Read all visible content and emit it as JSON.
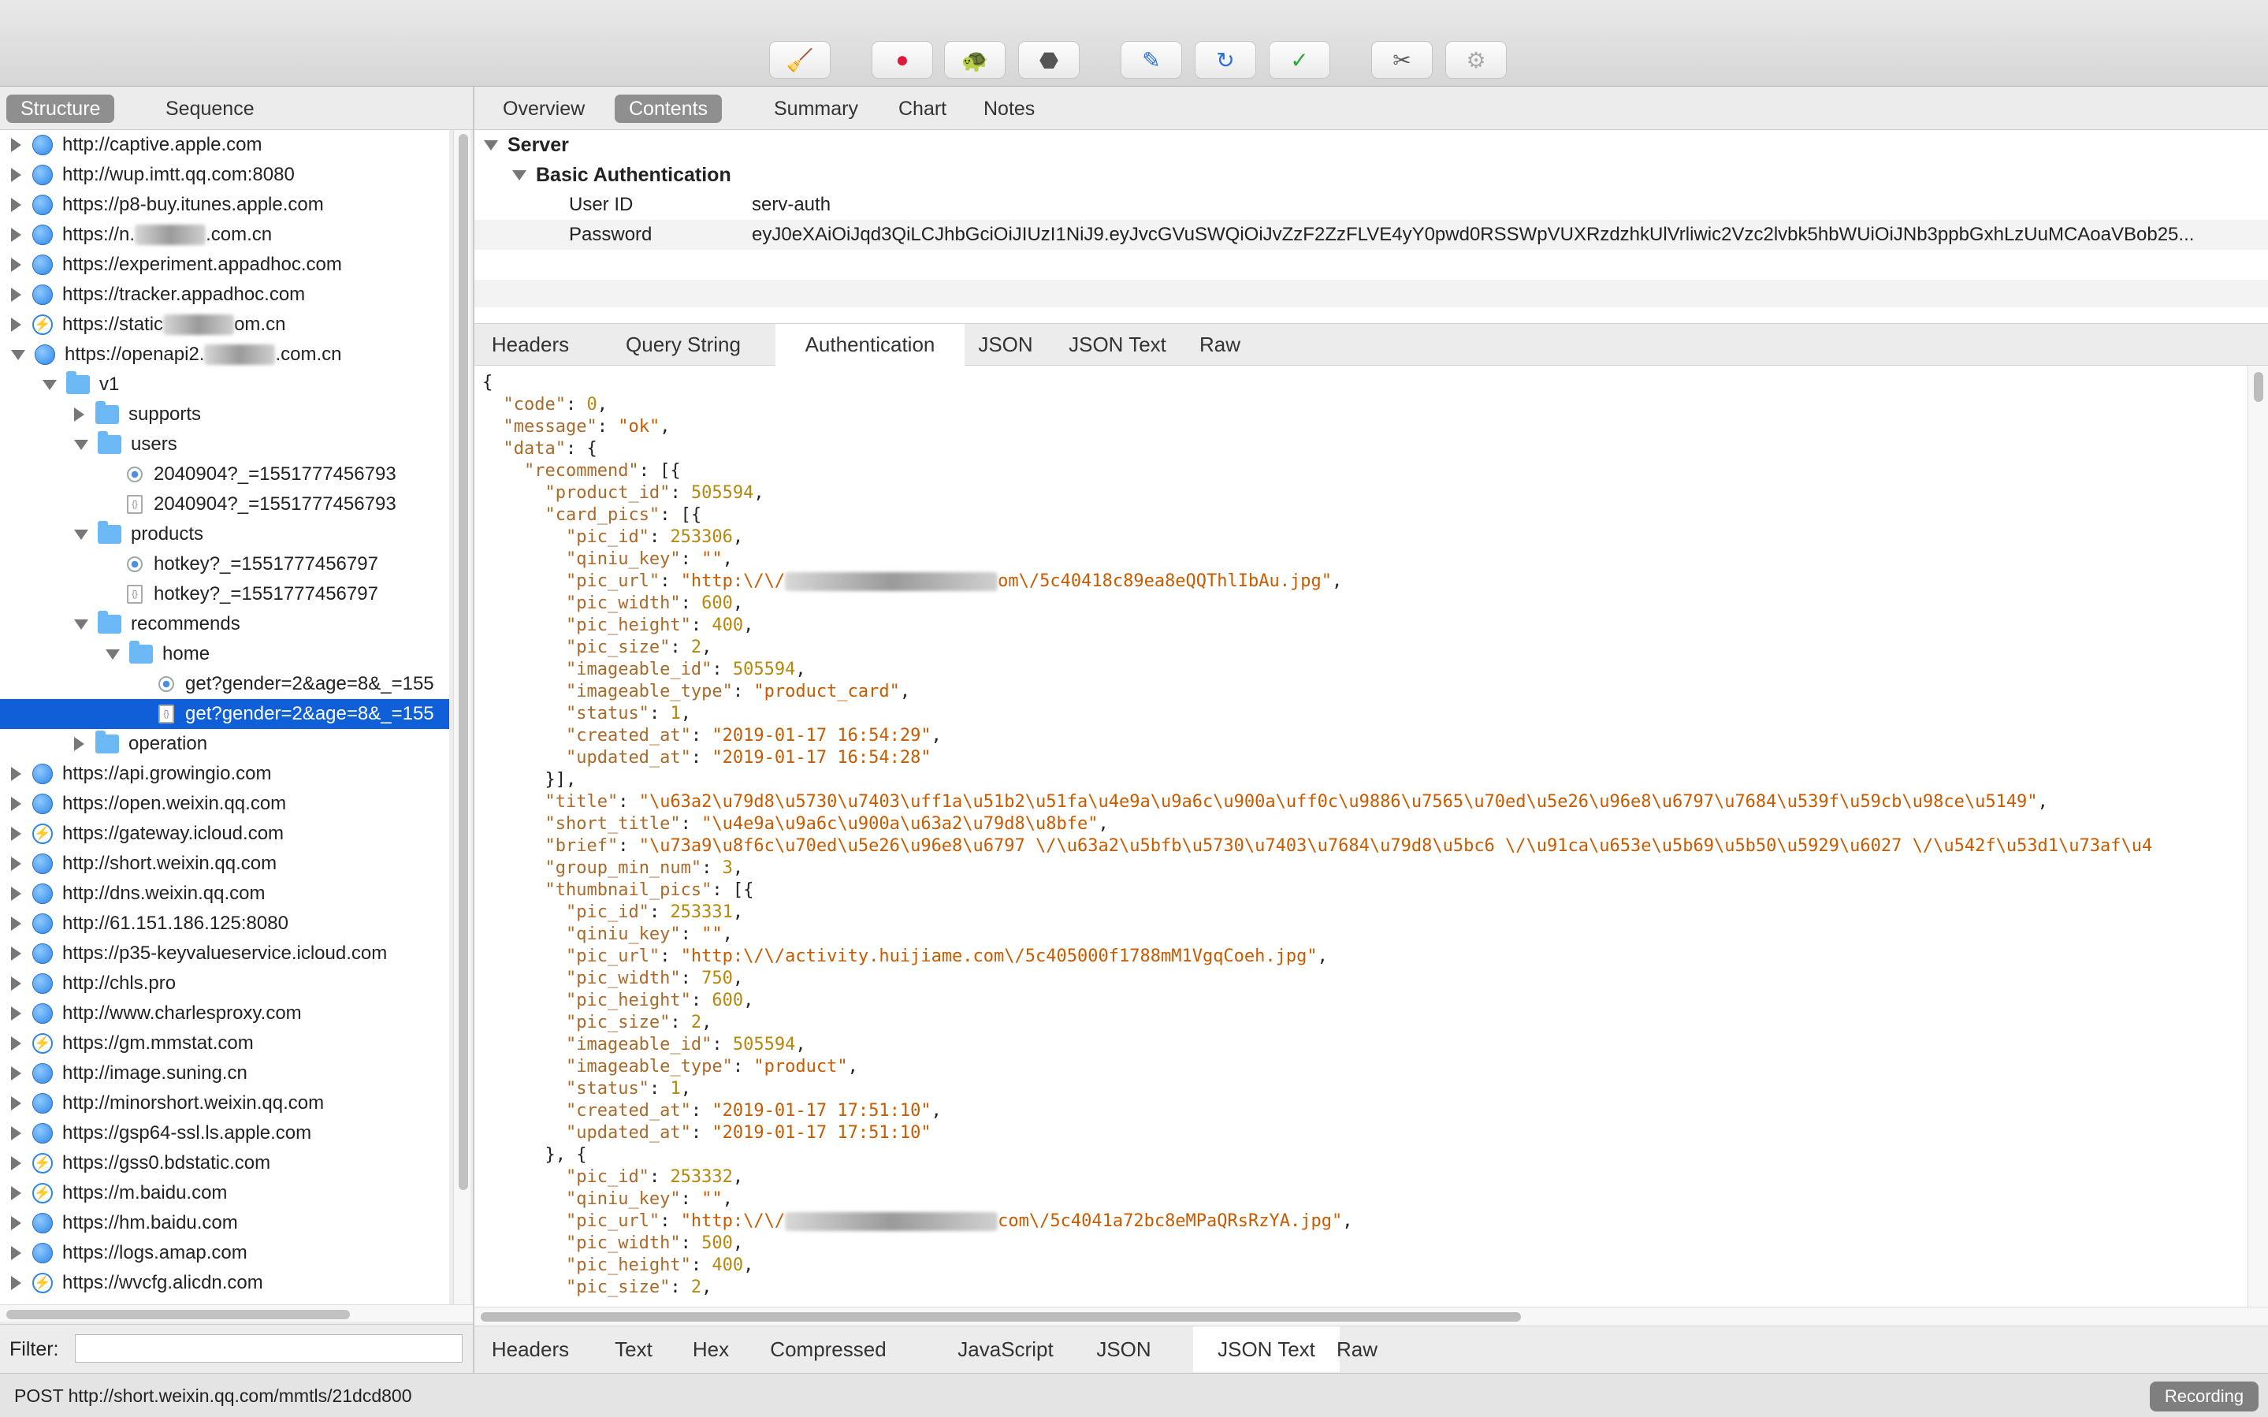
{
  "toolbar": {
    "buttons": [
      {
        "name": "broom-icon",
        "glyph": "🧹"
      },
      {
        "name": "record-icon",
        "glyph": "●"
      },
      {
        "name": "turtle-icon",
        "glyph": "🐢"
      },
      {
        "name": "stop-icon",
        "glyph": "⬣"
      },
      {
        "name": "pen-icon",
        "glyph": "✎"
      },
      {
        "name": "refresh-icon",
        "glyph": "↻"
      },
      {
        "name": "check-icon",
        "glyph": "✓"
      },
      {
        "name": "tools-icon",
        "glyph": "✂"
      },
      {
        "name": "settings-icon",
        "glyph": "⚙"
      }
    ]
  },
  "left": {
    "tabs": [
      "Structure",
      "Sequence"
    ],
    "tree": [
      {
        "level": 0,
        "disc": "closed",
        "icon": "globe",
        "label": "http://captive.apple.com"
      },
      {
        "level": 0,
        "disc": "closed",
        "icon": "globe",
        "label": "http://wup.imtt.qq.com:8080"
      },
      {
        "level": 0,
        "disc": "closed",
        "icon": "globe",
        "label": "https://p8-buy.itunes.apple.com"
      },
      {
        "level": 0,
        "disc": "closed",
        "icon": "globe",
        "label": "https://n.",
        "label2": ".com.cn"
      },
      {
        "level": 0,
        "disc": "closed",
        "icon": "globe",
        "label": "https://experiment.appadhoc.com"
      },
      {
        "level": 0,
        "disc": "closed",
        "icon": "globe",
        "label": "https://tracker.appadhoc.com"
      },
      {
        "level": 0,
        "disc": "closed",
        "icon": "bolt",
        "label": "https://static",
        "label2": "om.cn"
      },
      {
        "level": 0,
        "disc": "open",
        "icon": "globe",
        "label": "https://openapi2.",
        "label2": ".com.cn"
      },
      {
        "level": 1,
        "disc": "open",
        "icon": "folder",
        "label": "v1"
      },
      {
        "level": 2,
        "disc": "closed",
        "icon": "folder",
        "label": "supports"
      },
      {
        "level": 2,
        "disc": "open",
        "icon": "folder",
        "label": "users"
      },
      {
        "level": 3,
        "disc": "none",
        "icon": "req",
        "label": "2040904?_=1551777456793"
      },
      {
        "level": 3,
        "disc": "none",
        "icon": "doc",
        "label": "2040904?_=1551777456793"
      },
      {
        "level": 2,
        "disc": "open",
        "icon": "folder",
        "label": "products"
      },
      {
        "level": 3,
        "disc": "none",
        "icon": "req",
        "label": "hotkey?_=1551777456797"
      },
      {
        "level": 3,
        "disc": "none",
        "icon": "doc",
        "label": "hotkey?_=1551777456797"
      },
      {
        "level": 2,
        "disc": "open",
        "icon": "folder",
        "label": "recommends"
      },
      {
        "level": 3,
        "disc": "open",
        "icon": "folder",
        "label": "home"
      },
      {
        "level": 4,
        "disc": "none",
        "icon": "req",
        "label": "get?gender=2&age=8&_=155"
      },
      {
        "level": 4,
        "disc": "none",
        "icon": "doc",
        "label": "get?gender=2&age=8&_=155",
        "selected": true
      },
      {
        "level": 2,
        "disc": "closed",
        "icon": "folder",
        "label": "operation"
      },
      {
        "level": 0,
        "disc": "closed",
        "icon": "globe",
        "label": "https://api.growingio.com"
      },
      {
        "level": 0,
        "disc": "closed",
        "icon": "globe",
        "label": "https://open.weixin.qq.com"
      },
      {
        "level": 0,
        "disc": "closed",
        "icon": "bolt",
        "label": "https://gateway.icloud.com"
      },
      {
        "level": 0,
        "disc": "closed",
        "icon": "globe",
        "label": "http://short.weixin.qq.com"
      },
      {
        "level": 0,
        "disc": "closed",
        "icon": "globe",
        "label": "http://dns.weixin.qq.com"
      },
      {
        "level": 0,
        "disc": "closed",
        "icon": "globe",
        "label": "http://61.151.186.125:8080"
      },
      {
        "level": 0,
        "disc": "closed",
        "icon": "globe",
        "label": "https://p35-keyvalueservice.icloud.com"
      },
      {
        "level": 0,
        "disc": "closed",
        "icon": "globe",
        "label": "http://chls.pro"
      },
      {
        "level": 0,
        "disc": "closed",
        "icon": "globe",
        "label": "http://www.charlesproxy.com"
      },
      {
        "level": 0,
        "disc": "closed",
        "icon": "bolt",
        "label": "https://gm.mmstat.com"
      },
      {
        "level": 0,
        "disc": "closed",
        "icon": "globe",
        "label": "http://image.suning.cn"
      },
      {
        "level": 0,
        "disc": "closed",
        "icon": "globe",
        "label": "http://minorshort.weixin.qq.com"
      },
      {
        "level": 0,
        "disc": "closed",
        "icon": "globe",
        "label": "https://gsp64-ssl.ls.apple.com"
      },
      {
        "level": 0,
        "disc": "closed",
        "icon": "bolt",
        "label": "https://gss0.bdstatic.com"
      },
      {
        "level": 0,
        "disc": "closed",
        "icon": "bolt",
        "label": "https://m.baidu.com"
      },
      {
        "level": 0,
        "disc": "closed",
        "icon": "globe",
        "label": "https://hm.baidu.com"
      },
      {
        "level": 0,
        "disc": "closed",
        "icon": "globe",
        "label": "https://logs.amap.com"
      },
      {
        "level": 0,
        "disc": "closed",
        "icon": "bolt",
        "label": "https://wvcfg.alicdn.com"
      }
    ],
    "filter_label": "Filter:",
    "filter_value": ""
  },
  "right": {
    "tabs": [
      "Overview",
      "Contents",
      "Summary",
      "Chart",
      "Notes"
    ],
    "active_tab": "Contents",
    "auth": {
      "server_label": "Server",
      "basic_label": "Basic Authentication",
      "rows": [
        {
          "key": "User ID",
          "value": "serv-auth"
        },
        {
          "key": "Password",
          "value": "eyJ0eXAiOiJqd3QiLCJhbGciOiJIUzI1NiJ9.eyJvcGVuSWQiOiJvZzF2ZzFLVE4yY0pwd0RSSWpVUXRzdzhkUlVrliwic2Vzc2lvbk5hbWUiOiJNb3ppbGxhLzUuMCAoaVBob25..."
        }
      ]
    },
    "request_tabs": [
      "Headers",
      "Query String",
      "Authentication",
      "JSON",
      "JSON Text",
      "Raw"
    ],
    "request_active": "Authentication",
    "json_lines": [
      [
        [
          "p",
          "{"
        ]
      ],
      [
        [
          "p",
          "  "
        ],
        [
          "k",
          "\"code\""
        ],
        [
          "p",
          ": "
        ],
        [
          "n",
          "0"
        ],
        [
          "p",
          ","
        ]
      ],
      [
        [
          "p",
          "  "
        ],
        [
          "k",
          "\"message\""
        ],
        [
          "p",
          ": "
        ],
        [
          "s",
          "\"ok\""
        ],
        [
          "p",
          ","
        ]
      ],
      [
        [
          "p",
          "  "
        ],
        [
          "k",
          "\"data\""
        ],
        [
          "p",
          ": {"
        ]
      ],
      [
        [
          "p",
          "    "
        ],
        [
          "k",
          "\"recommend\""
        ],
        [
          "p",
          ": [{"
        ]
      ],
      [
        [
          "p",
          "      "
        ],
        [
          "k",
          "\"product_id\""
        ],
        [
          "p",
          ": "
        ],
        [
          "n",
          "505594"
        ],
        [
          "p",
          ","
        ]
      ],
      [
        [
          "p",
          "      "
        ],
        [
          "k",
          "\"card_pics\""
        ],
        [
          "p",
          ": [{"
        ]
      ],
      [
        [
          "p",
          "        "
        ],
        [
          "k",
          "\"pic_id\""
        ],
        [
          "p",
          ": "
        ],
        [
          "n",
          "253306"
        ],
        [
          "p",
          ","
        ]
      ],
      [
        [
          "p",
          "        "
        ],
        [
          "k",
          "\"qiniu_key\""
        ],
        [
          "p",
          ": "
        ],
        [
          "s",
          "\"\""
        ],
        [
          "p",
          ","
        ]
      ],
      [
        [
          "p",
          "        "
        ],
        [
          "k",
          "\"pic_url\""
        ],
        [
          "p",
          ": "
        ],
        [
          "s",
          "\"http:\\/\\/"
        ],
        [
          "b",
          "              "
        ],
        [
          "s",
          "om\\/5c40418c89ea8eQQThlIbAu.jpg\""
        ],
        [
          "p",
          ","
        ]
      ],
      [
        [
          "p",
          "        "
        ],
        [
          "k",
          "\"pic_width\""
        ],
        [
          "p",
          ": "
        ],
        [
          "n",
          "600"
        ],
        [
          "p",
          ","
        ]
      ],
      [
        [
          "p",
          "        "
        ],
        [
          "k",
          "\"pic_height\""
        ],
        [
          "p",
          ": "
        ],
        [
          "n",
          "400"
        ],
        [
          "p",
          ","
        ]
      ],
      [
        [
          "p",
          "        "
        ],
        [
          "k",
          "\"pic_size\""
        ],
        [
          "p",
          ": "
        ],
        [
          "n",
          "2"
        ],
        [
          "p",
          ","
        ]
      ],
      [
        [
          "p",
          "        "
        ],
        [
          "k",
          "\"imageable_id\""
        ],
        [
          "p",
          ": "
        ],
        [
          "n",
          "505594"
        ],
        [
          "p",
          ","
        ]
      ],
      [
        [
          "p",
          "        "
        ],
        [
          "k",
          "\"imageable_type\""
        ],
        [
          "p",
          ": "
        ],
        [
          "s",
          "\"product_card\""
        ],
        [
          "p",
          ","
        ]
      ],
      [
        [
          "p",
          "        "
        ],
        [
          "k",
          "\"status\""
        ],
        [
          "p",
          ": "
        ],
        [
          "n",
          "1"
        ],
        [
          "p",
          ","
        ]
      ],
      [
        [
          "p",
          "        "
        ],
        [
          "k",
          "\"created_at\""
        ],
        [
          "p",
          ": "
        ],
        [
          "s",
          "\"2019-01-17 16:54:29\""
        ],
        [
          "p",
          ","
        ]
      ],
      [
        [
          "p",
          "        "
        ],
        [
          "k",
          "\"updated_at\""
        ],
        [
          "p",
          ": "
        ],
        [
          "s",
          "\"2019-01-17 16:54:28\""
        ]
      ],
      [
        [
          "p",
          "      }],"
        ]
      ],
      [
        [
          "p",
          "      "
        ],
        [
          "k",
          "\"title\""
        ],
        [
          "p",
          ": "
        ],
        [
          "s",
          "\"\\u63a2\\u79d8\\u5730\\u7403\\uff1a\\u51b2\\u51fa\\u4e9a\\u9a6c\\u900a\\uff0c\\u9886\\u7565\\u70ed\\u5e26\\u96e8\\u6797\\u7684\\u539f\\u59cb\\u98ce\\u5149\""
        ],
        [
          "p",
          ","
        ]
      ],
      [
        [
          "p",
          "      "
        ],
        [
          "k",
          "\"short_title\""
        ],
        [
          "p",
          ": "
        ],
        [
          "s",
          "\"\\u4e9a\\u9a6c\\u900a\\u63a2\\u79d8\\u8bfe\""
        ],
        [
          "p",
          ","
        ]
      ],
      [
        [
          "p",
          "      "
        ],
        [
          "k",
          "\"brief\""
        ],
        [
          "p",
          ": "
        ],
        [
          "s",
          "\"\\u73a9\\u8f6c\\u70ed\\u5e26\\u96e8\\u6797 \\/\\u63a2\\u5bfb\\u5730\\u7403\\u7684\\u79d8\\u5bc6 \\/\\u91ca\\u653e\\u5b69\\u5b50\\u5929\\u6027 \\/\\u542f\\u53d1\\u73af\\u4"
        ]
      ],
      [
        [
          "p",
          "      "
        ],
        [
          "k",
          "\"group_min_num\""
        ],
        [
          "p",
          ": "
        ],
        [
          "n",
          "3"
        ],
        [
          "p",
          ","
        ]
      ],
      [
        [
          "p",
          "      "
        ],
        [
          "k",
          "\"thumbnail_pics\""
        ],
        [
          "p",
          ": [{"
        ]
      ],
      [
        [
          "p",
          "        "
        ],
        [
          "k",
          "\"pic_id\""
        ],
        [
          "p",
          ": "
        ],
        [
          "n",
          "253331"
        ],
        [
          "p",
          ","
        ]
      ],
      [
        [
          "p",
          "        "
        ],
        [
          "k",
          "\"qiniu_key\""
        ],
        [
          "p",
          ": "
        ],
        [
          "s",
          "\"\""
        ],
        [
          "p",
          ","
        ]
      ],
      [
        [
          "p",
          "        "
        ],
        [
          "k",
          "\"pic_url\""
        ],
        [
          "p",
          ": "
        ],
        [
          "s",
          "\"http:\\/\\/activity.huijiame.com\\/5c405000f1788mM1VgqCoeh.jpg\""
        ],
        [
          "p",
          ","
        ]
      ],
      [
        [
          "p",
          "        "
        ],
        [
          "k",
          "\"pic_width\""
        ],
        [
          "p",
          ": "
        ],
        [
          "n",
          "750"
        ],
        [
          "p",
          ","
        ]
      ],
      [
        [
          "p",
          "        "
        ],
        [
          "k",
          "\"pic_height\""
        ],
        [
          "p",
          ": "
        ],
        [
          "n",
          "600"
        ],
        [
          "p",
          ","
        ]
      ],
      [
        [
          "p",
          "        "
        ],
        [
          "k",
          "\"pic_size\""
        ],
        [
          "p",
          ": "
        ],
        [
          "n",
          "2"
        ],
        [
          "p",
          ","
        ]
      ],
      [
        [
          "p",
          "        "
        ],
        [
          "k",
          "\"imageable_id\""
        ],
        [
          "p",
          ": "
        ],
        [
          "n",
          "505594"
        ],
        [
          "p",
          ","
        ]
      ],
      [
        [
          "p",
          "        "
        ],
        [
          "k",
          "\"imageable_type\""
        ],
        [
          "p",
          ": "
        ],
        [
          "s",
          "\"product\""
        ],
        [
          "p",
          ","
        ]
      ],
      [
        [
          "p",
          "        "
        ],
        [
          "k",
          "\"status\""
        ],
        [
          "p",
          ": "
        ],
        [
          "n",
          "1"
        ],
        [
          "p",
          ","
        ]
      ],
      [
        [
          "p",
          "        "
        ],
        [
          "k",
          "\"created_at\""
        ],
        [
          "p",
          ": "
        ],
        [
          "s",
          "\"2019-01-17 17:51:10\""
        ],
        [
          "p",
          ","
        ]
      ],
      [
        [
          "p",
          "        "
        ],
        [
          "k",
          "\"updated_at\""
        ],
        [
          "p",
          ": "
        ],
        [
          "s",
          "\"2019-01-17 17:51:10\""
        ]
      ],
      [
        [
          "p",
          "      }, {"
        ]
      ],
      [
        [
          "p",
          "        "
        ],
        [
          "k",
          "\"pic_id\""
        ],
        [
          "p",
          ": "
        ],
        [
          "n",
          "253332"
        ],
        [
          "p",
          ","
        ]
      ],
      [
        [
          "p",
          "        "
        ],
        [
          "k",
          "\"qiniu_key\""
        ],
        [
          "p",
          ": "
        ],
        [
          "s",
          "\"\""
        ],
        [
          "p",
          ","
        ]
      ],
      [
        [
          "p",
          "        "
        ],
        [
          "k",
          "\"pic_url\""
        ],
        [
          "p",
          ": "
        ],
        [
          "s",
          "\"http:\\/\\/"
        ],
        [
          "b",
          "              "
        ],
        [
          "s",
          "com\\/5c4041a72bc8eMPaQRsRzYA.jpg\""
        ],
        [
          "p",
          ","
        ]
      ],
      [
        [
          "p",
          "        "
        ],
        [
          "k",
          "\"pic_width\""
        ],
        [
          "p",
          ": "
        ],
        [
          "n",
          "500"
        ],
        [
          "p",
          ","
        ]
      ],
      [
        [
          "p",
          "        "
        ],
        [
          "k",
          "\"pic_height\""
        ],
        [
          "p",
          ": "
        ],
        [
          "n",
          "400"
        ],
        [
          "p",
          ","
        ]
      ],
      [
        [
          "p",
          "        "
        ],
        [
          "k",
          "\"pic_size\""
        ],
        [
          "p",
          ": "
        ],
        [
          "n",
          "2"
        ],
        [
          "p",
          ","
        ]
      ]
    ],
    "response_tabs": [
      "Headers",
      "Text",
      "Hex",
      "Compressed",
      "JavaScript",
      "JSON",
      "JSON Text",
      "Raw"
    ],
    "response_active": "JSON Text"
  },
  "status": {
    "text": "POST http://short.weixin.qq.com/mmtls/21dcd800",
    "recording": "Recording"
  },
  "colors": {
    "selection": "#0e5fd8",
    "json_key": "#a96a2b",
    "json_string": "#c85b00",
    "json_number": "#b5880c"
  }
}
